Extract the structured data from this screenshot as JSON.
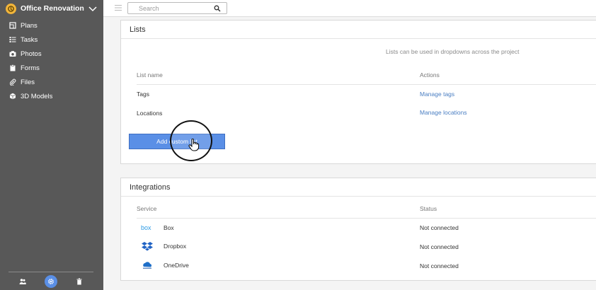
{
  "project": {
    "name": "Office Renovation"
  },
  "nav": [
    {
      "label": "Plans",
      "icon": "plans-icon"
    },
    {
      "label": "Tasks",
      "icon": "tasks-icon"
    },
    {
      "label": "Photos",
      "icon": "camera-icon"
    },
    {
      "label": "Forms",
      "icon": "clipboard-icon"
    },
    {
      "label": "Files",
      "icon": "paperclip-icon"
    },
    {
      "label": "3D Models",
      "icon": "cube-icon"
    }
  ],
  "search": {
    "placeholder": "Search"
  },
  "lists": {
    "title": "Lists",
    "hint": "Lists can be used in dropdowns across the project",
    "columns": {
      "name": "List name",
      "actions": "Actions"
    },
    "rows": [
      {
        "name": "Tags",
        "action": "Manage tags"
      },
      {
        "name": "Locations",
        "action": "Manage locations"
      }
    ],
    "add_button": "Add custom list"
  },
  "integrations": {
    "title": "Integrations",
    "columns": {
      "service": "Service",
      "status": "Status"
    },
    "rows": [
      {
        "service": "Box",
        "status": "Not connected",
        "icon": "box-icon"
      },
      {
        "service": "Dropbox",
        "status": "Not connected",
        "icon": "dropbox-icon"
      },
      {
        "service": "OneDrive",
        "status": "Not connected",
        "icon": "onedrive-icon"
      }
    ]
  },
  "colors": {
    "sidebar": "#585858",
    "accent": "#5a8fe6",
    "link": "#4a7ec2"
  }
}
